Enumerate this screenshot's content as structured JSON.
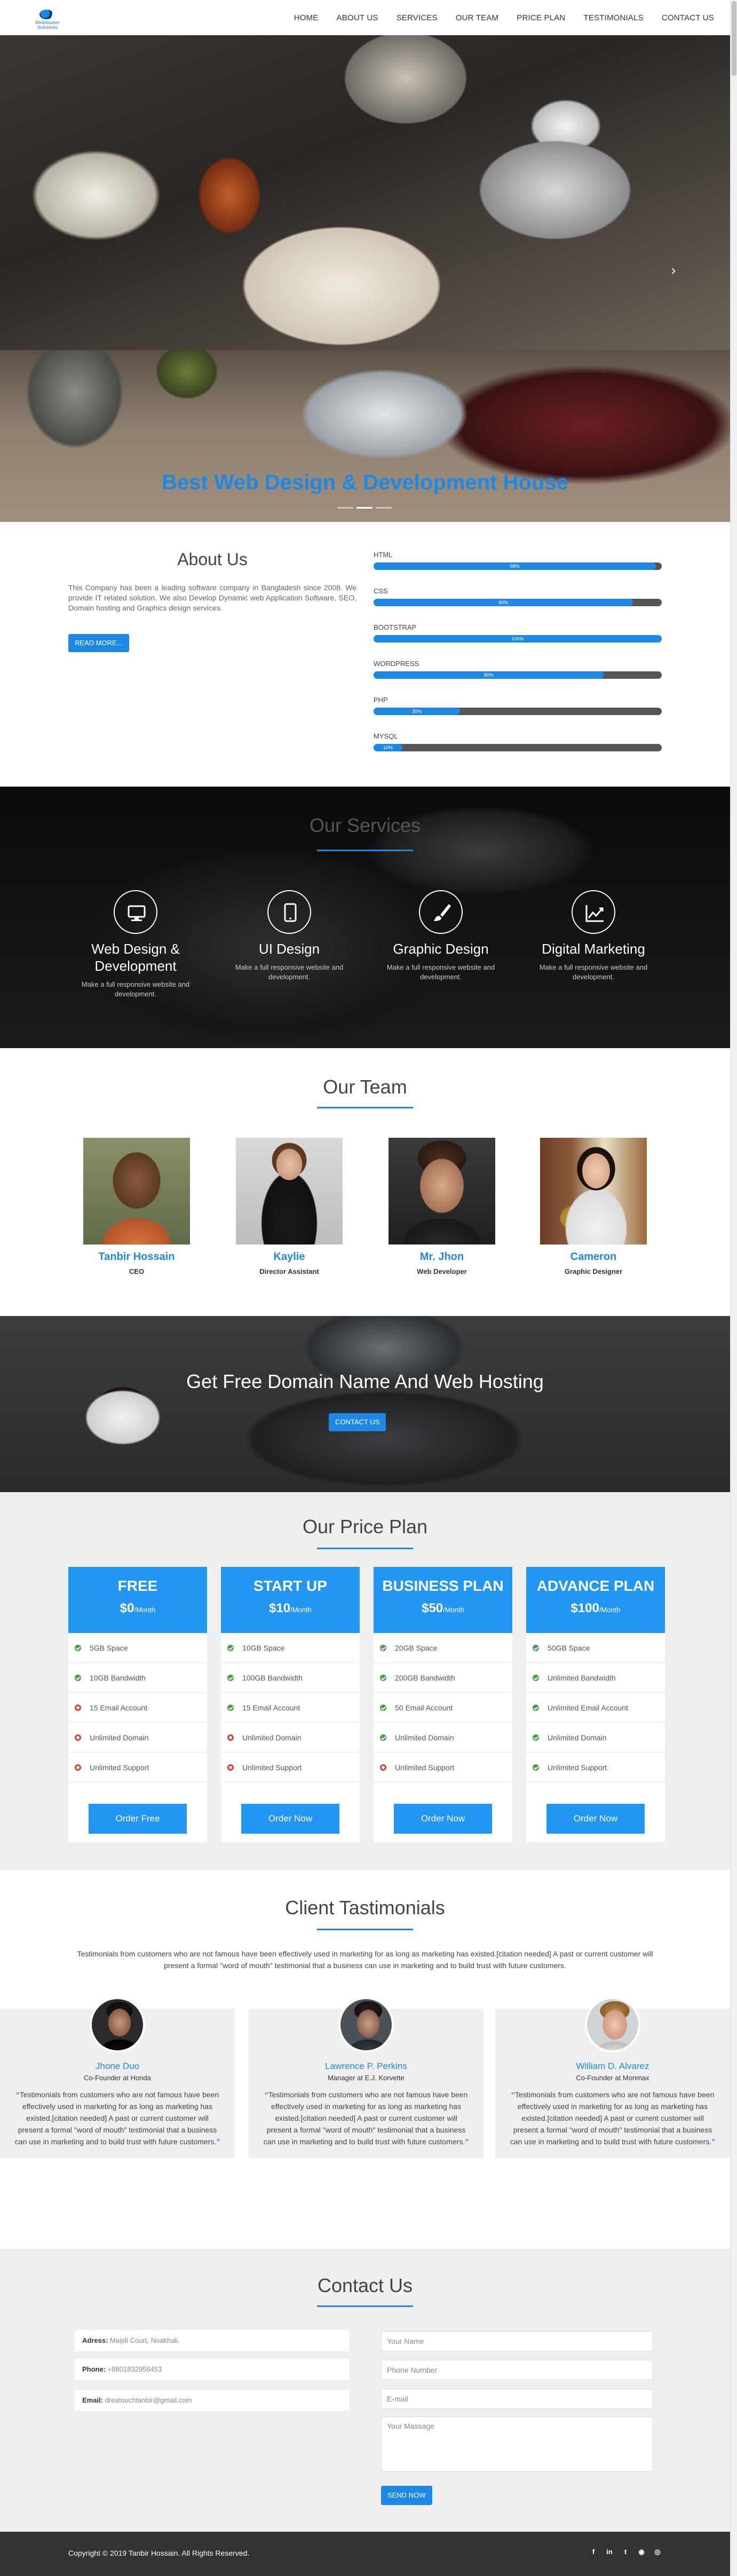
{
  "nav": {
    "logo_text": "Webmaster Solutions",
    "items": [
      "HOME",
      "ABOUT US",
      "SERVICES",
      "OUR TEAM",
      "PRICE PLAN",
      "TESTIMONIALS",
      "CONTACT US"
    ]
  },
  "hero": {
    "title": "Best Web Design & Development House",
    "next_arrow": "›"
  },
  "about": {
    "title": "About Us",
    "text": "This Company has been a leading software company in Bangladesh since 2008. We provide IT related solution. We also Develop Dynamic web Application Software, SEO, Domain hosting and Graphics design services.",
    "button": "READ MORE...",
    "skills": [
      {
        "name": "HTML",
        "percent": 98,
        "label": "98%"
      },
      {
        "name": "CSS",
        "percent": 90,
        "label": "90%"
      },
      {
        "name": "BOOTSTRAP",
        "percent": 100,
        "label": "100%"
      },
      {
        "name": "WORDPRESS",
        "percent": 80,
        "label": "80%"
      },
      {
        "name": "PHP",
        "percent": 30,
        "label": "30%"
      },
      {
        "name": "MYSQL",
        "percent": 10,
        "label": "10%"
      }
    ]
  },
  "services": {
    "title": "Our Services",
    "items": [
      {
        "icon": "monitor-icon",
        "title": "Web Design & Development",
        "desc": "Make a full responsive website and development."
      },
      {
        "icon": "mobile-icon",
        "title": "UI Design",
        "desc": "Make a full responsive website and development."
      },
      {
        "icon": "brush-icon",
        "title": "Graphic Design",
        "desc": "Make a full responsive website and development."
      },
      {
        "icon": "chart-icon",
        "title": "Digital Marketing",
        "desc": "Make a full responsive website and development."
      }
    ]
  },
  "team": {
    "title": "Our Team",
    "members": [
      {
        "name": "Tanbir Hossain",
        "role": "CEO"
      },
      {
        "name": "Kaylie",
        "role": "Director Assistant"
      },
      {
        "name": "Mr. Jhon",
        "role": "Web Developer"
      },
      {
        "name": "Cameron",
        "role": "Graphic Designer"
      }
    ]
  },
  "domain": {
    "title": "Get Free Domain Name And Web Hosting",
    "button": "CONTACT US"
  },
  "price": {
    "title": "Our Price Plan",
    "plans": [
      {
        "name": "FREE",
        "price": "$0",
        "per": "/Month",
        "button": "Order Free",
        "features": [
          [
            "ok",
            "5GB Space"
          ],
          [
            "ok",
            "10GB Bandwidth"
          ],
          [
            "no",
            "15 Email Account"
          ],
          [
            "no",
            "Unlimited Domain"
          ],
          [
            "no",
            "Unlimited Support"
          ]
        ]
      },
      {
        "name": "START UP",
        "price": "$10",
        "per": "/Month",
        "button": "Order Now",
        "features": [
          [
            "ok",
            "10GB Space"
          ],
          [
            "ok",
            "100GB Bandwidth"
          ],
          [
            "ok",
            "15 Email Account"
          ],
          [
            "no",
            "Unlimited Domain"
          ],
          [
            "no",
            "Unlimited Support"
          ]
        ]
      },
      {
        "name": "BUSINESS PLAN",
        "price": "$50",
        "per": "/Month",
        "button": "Order Now",
        "features": [
          [
            "ok",
            "20GB Space"
          ],
          [
            "ok",
            "200GB Bandwidth"
          ],
          [
            "ok",
            "50 Email Account"
          ],
          [
            "ok",
            "Unlimited Domain"
          ],
          [
            "no",
            "Unlimited Support"
          ]
        ]
      },
      {
        "name": "ADVANCE PLAN",
        "price": "$100",
        "per": "/Month",
        "button": "Order Now",
        "features": [
          [
            "ok",
            "50GB Space"
          ],
          [
            "ok",
            "Unlimited Bandwidth"
          ],
          [
            "ok",
            "Unlimited Email Account"
          ],
          [
            "ok",
            "Unlimited Domain"
          ],
          [
            "ok",
            "Unlimited Support"
          ]
        ]
      }
    ]
  },
  "testimonials": {
    "title": "Client Tastimonials",
    "intro": "Testimonials from customers who are not famous have been effectively used in marketing for as long as marketing has existed.[citation needed] A past or current customer will present a formal \"word of mouth\" testimonial that a business can use in marketing and to build trust with future customers.",
    "items": [
      {
        "name": "Jhone Duo",
        "role": "Co-Founder at Honda",
        "quote": "Testimonials from customers who are not famous have been effectively used in marketing for as long as marketing has existed.[citation needed] A past or current customer will present a formal \"word of mouth\" testimonial that a business can use in marketing and to build trust with future customers."
      },
      {
        "name": "Lawrence P. Perkins",
        "role": "Manager at E.J. Korvette",
        "quote": "Testimonials from customers who are not famous have been effectively used in marketing for as long as marketing has existed.[citation needed] A past or current customer will present a formal \"word of mouth\" testimonial that a business can use in marketing and to build trust with future customers."
      },
      {
        "name": "William D. Alvarez",
        "role": "Co-Founder at Monmax",
        "quote": "Testimonials from customers who are not famous have been effectively used in marketing for as long as marketing has existed.[citation needed] A past or current customer will present a formal \"word of mouth\" testimonial that a business can use in marketing and to build trust with future customers."
      }
    ]
  },
  "contact": {
    "title": "Contact Us",
    "address_label": "Adress:",
    "address_value": "Maijdi Court, Noakhali.",
    "phone_label": "Phone:",
    "phone_value": "+8801832956453",
    "email_label": "Email:",
    "email_value": "dreatouchtanbir@gmail.com",
    "name_placeholder": "Your Name",
    "number_placeholder": "Phone Number",
    "email_placeholder": "E-mail",
    "message_placeholder": "Your Massage",
    "send_button": "SEND NOW"
  },
  "footer": {
    "copyright": "Copyright © 2019 Tanbir Hossain. All Rights Reserved.",
    "social": [
      {
        "icon": "facebook-icon",
        "glyph": "f"
      },
      {
        "icon": "linkedin-icon",
        "glyph": "in"
      },
      {
        "icon": "twitter-icon",
        "glyph": "t"
      },
      {
        "icon": "github-icon",
        "glyph": "◉"
      },
      {
        "icon": "instagram-icon",
        "glyph": "◎"
      }
    ]
  },
  "colors": {
    "accent": "#1e88e5",
    "plan_header": "#2196f3",
    "ok": "#43a047",
    "no": "#e53935",
    "footer": "#333333"
  }
}
